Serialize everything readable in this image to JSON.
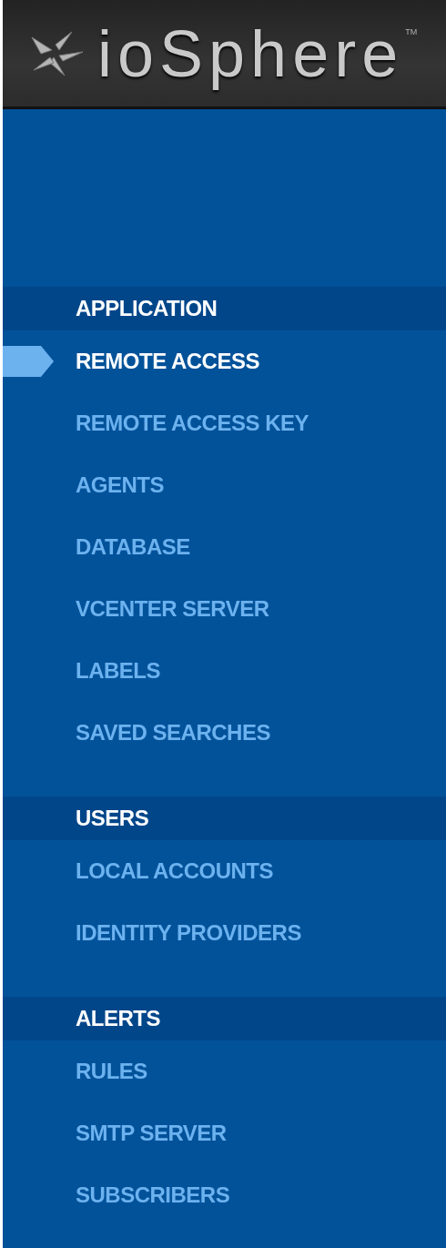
{
  "header": {
    "logo_text": "ioSphere",
    "trademark": "TM"
  },
  "sections": [
    {
      "title": "APPLICATION",
      "items": [
        {
          "label": "REMOTE ACCESS",
          "selected": true
        },
        {
          "label": "REMOTE ACCESS KEY",
          "selected": false
        },
        {
          "label": "AGENTS",
          "selected": false
        },
        {
          "label": "DATABASE",
          "selected": false
        },
        {
          "label": "VCENTER SERVER",
          "selected": false
        },
        {
          "label": "LABELS",
          "selected": false
        },
        {
          "label": "SAVED SEARCHES",
          "selected": false
        }
      ]
    },
    {
      "title": "USERS",
      "items": [
        {
          "label": "LOCAL ACCOUNTS",
          "selected": false
        },
        {
          "label": "IDENTITY PROVIDERS",
          "selected": false
        }
      ]
    },
    {
      "title": "ALERTS",
      "items": [
        {
          "label": "RULES",
          "selected": false
        },
        {
          "label": "SMTP SERVER",
          "selected": false
        },
        {
          "label": "SUBSCRIBERS",
          "selected": false
        }
      ]
    }
  ]
}
